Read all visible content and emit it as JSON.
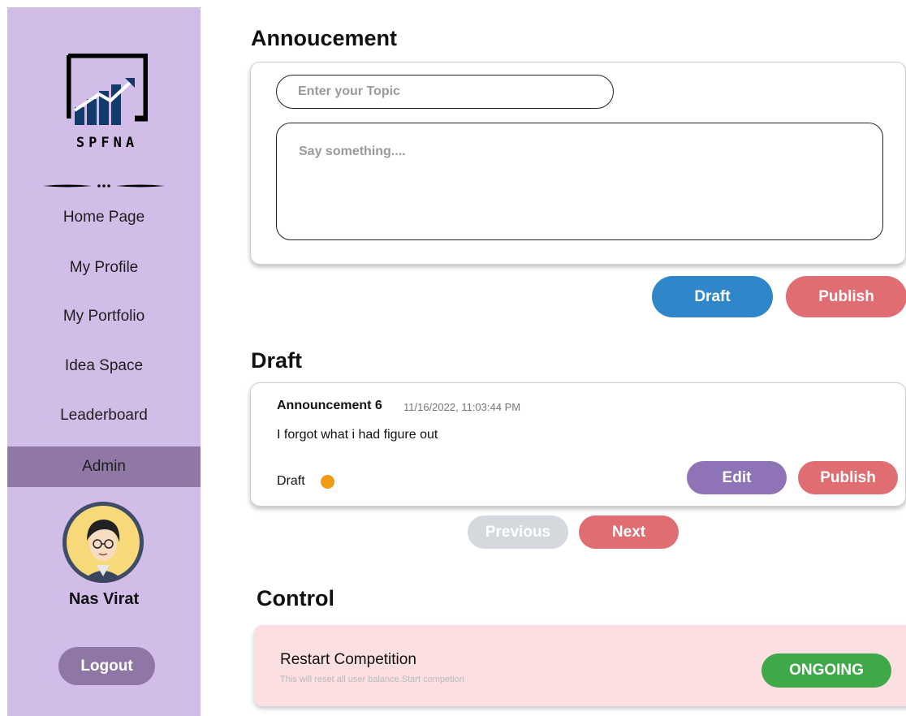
{
  "sidebar": {
    "logo_text": "SPFNA",
    "nav_items": [
      {
        "label": "Home Page"
      },
      {
        "label": "My Profile"
      },
      {
        "label": "My Portfolio"
      },
      {
        "label": "Idea Space"
      },
      {
        "label": "Leaderboard"
      },
      {
        "label": "Admin",
        "active": true
      }
    ],
    "user_name": "Nas Virat",
    "logout_label": "Logout"
  },
  "announcement": {
    "title": "Annoucement",
    "topic_placeholder": "Enter your Topic",
    "body_placeholder": "Say something....",
    "draft_label": "Draft",
    "publish_label": "Publish"
  },
  "drafts": {
    "title": "Draft",
    "items": [
      {
        "title": "Announcement 6",
        "timestamp": "11/16/2022, 11:03:44 PM",
        "body": "I forgot what i had figure out",
        "status": "Draft",
        "edit_label": "Edit",
        "publish_label": "Publish"
      }
    ],
    "prev_label": "Previous",
    "next_label": "Next"
  },
  "control": {
    "title": "Control",
    "item_title": "Restart Competition",
    "item_desc": "This will reset all user balance.Start competion",
    "status_label": "ONGOING"
  },
  "colors": {
    "sidebar_bg": "#d2bce8",
    "sidebar_active": "#8f78a6",
    "draft_blue": "#2f86c9",
    "publish_red": "#df6d71",
    "edit_purple": "#8e73b6",
    "ongoing_green": "#3fa94a",
    "status_dot": "#f19a14"
  }
}
